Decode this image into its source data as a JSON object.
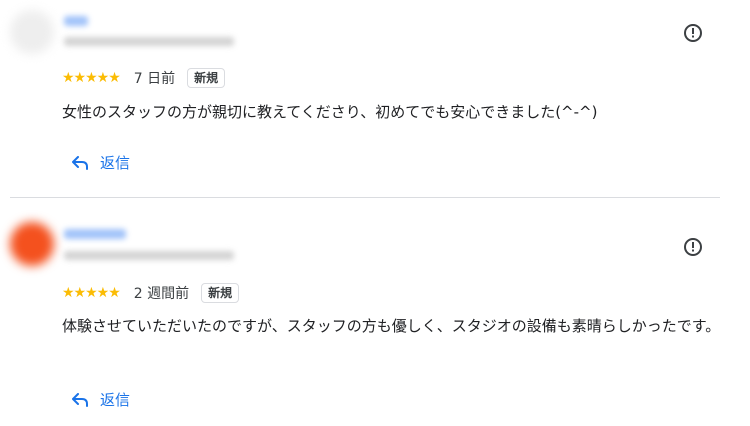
{
  "reviews": [
    {
      "stars": "★★★★★",
      "time": "7 日前",
      "badge": "新規",
      "text": "女性のスタッフの方が親切に教えてくださり、初めてでも安心できました(^-^)",
      "reply_label": "返信",
      "avatar_color": "#eeeeee"
    },
    {
      "stars": "★★★★★",
      "time": "2 週間前",
      "badge": "新規",
      "text": "体験させていただいたのですが、スタッフの方も優しく、スタジオの設備も素晴らしかったです。",
      "reply_label": "返信",
      "avatar_color": "#f4511e"
    }
  ],
  "colors": {
    "star": "#fbbc04",
    "link": "#1a73e8"
  },
  "icons": {
    "report": "report-flag-icon",
    "reply": "reply-arrow-icon"
  }
}
